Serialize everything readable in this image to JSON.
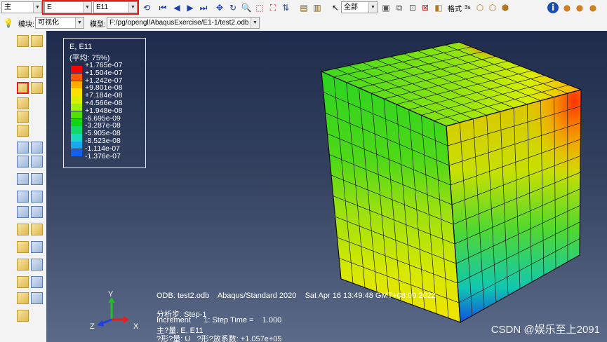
{
  "toolbar": {
    "part_combo": "主",
    "var_combo": "E",
    "comp_combo": "E11",
    "display_combo": "全部",
    "format_label": "格式",
    "format_value": "3s"
  },
  "toolbar2": {
    "module_label": "模块:",
    "module_value": "可视化",
    "model_label": "模型:",
    "model_value": "F:/pg/opengl/AbaqusExercise/E1-1/test2.odb"
  },
  "legend": {
    "title": "E, E11",
    "subtitle": "(平均: 75%)",
    "levels": [
      "+1.765e-07",
      "+1.504e-07",
      "+1.242e-07",
      "+9.801e-08",
      "+7.184e-08",
      "+4.566e-08",
      "+1.948e-08",
      "-6.695e-09",
      "-3.287e-08",
      "-5.905e-08",
      "-8.523e-08",
      "-1.114e-07",
      "-1.376e-07"
    ],
    "colors": [
      "#ff0000",
      "#ff5a00",
      "#ffaa00",
      "#ffe000",
      "#d8f000",
      "#a0f000",
      "#52e000",
      "#10d610",
      "#10d86a",
      "#18d8c0",
      "#18a8f0",
      "#1260f0",
      "#0010e0"
    ]
  },
  "info": {
    "line1": "ODB: test2.odb    Abaqus/Standard 2020    Sat Apr 16 13:49:48 GMT+08:00 2022",
    "line2": "分析步: Step-1",
    "line3": "Increment      1: Step Time =    1.000",
    "line4": "主?量: E, E11",
    "line5": "?形?量: U   ?形?放系数: +1.057e+05"
  },
  "triad": {
    "x": "X",
    "y": "Y",
    "z": "Z"
  },
  "watermark": "CSDN @娱乐至上2091"
}
